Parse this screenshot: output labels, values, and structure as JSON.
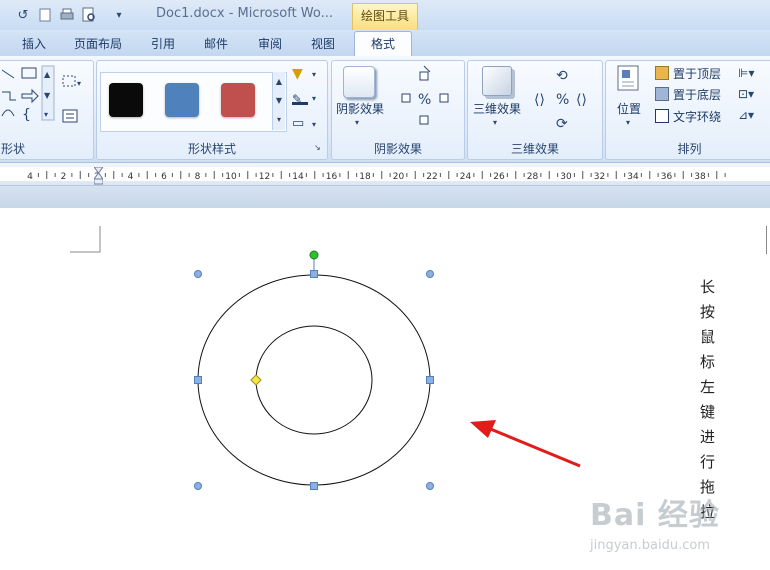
{
  "title_bar": {
    "doc_title": "Doc1.docx - Microsoft Wo...",
    "context_tool": "绘图工具"
  },
  "quick_access": [
    "undo-icon",
    "new-doc-icon",
    "print-icon",
    "print-preview-icon",
    "dropdown-icon"
  ],
  "tabs": {
    "items": [
      "插入",
      "页面布局",
      "引用",
      "邮件",
      "审阅",
      "视图"
    ],
    "active": "格式"
  },
  "ribbon": {
    "groups": {
      "insert_shapes": "形状",
      "shape_styles": "形状样式",
      "shadow": "阴影效果",
      "three_d": "三维效果",
      "arrange": "排列"
    },
    "shape_styles_swatches": [
      "#0a0a0a",
      "#4f81bd",
      "#c0504d"
    ],
    "shadow_button": "阴影效果",
    "three_d_button": "三维效果",
    "position_button": "位置",
    "bring_to_front": "置于顶层",
    "send_to_back": "置于底层",
    "text_wrap": "文字环绕"
  },
  "ruler": {
    "ticks": [
      "4",
      "2",
      "2",
      "4",
      "6",
      "8",
      "10",
      "12",
      "14",
      "16",
      "18",
      "20",
      "22",
      "24",
      "26",
      "28",
      "30",
      "32",
      "34",
      "36",
      "38"
    ]
  },
  "document": {
    "vertical_text": [
      "长",
      "按",
      "鼠",
      "标",
      "左",
      "键",
      "进",
      "行",
      "拖",
      "拉"
    ]
  },
  "watermark": {
    "brand": "Bai 经验",
    "url": "jingyan.baidu.com"
  },
  "colors": {
    "arrow": "#e21b1b",
    "handle": "#4f81bd",
    "rotate_handle": "#2fbf2f",
    "adjust_handle": "#f5e64a"
  }
}
